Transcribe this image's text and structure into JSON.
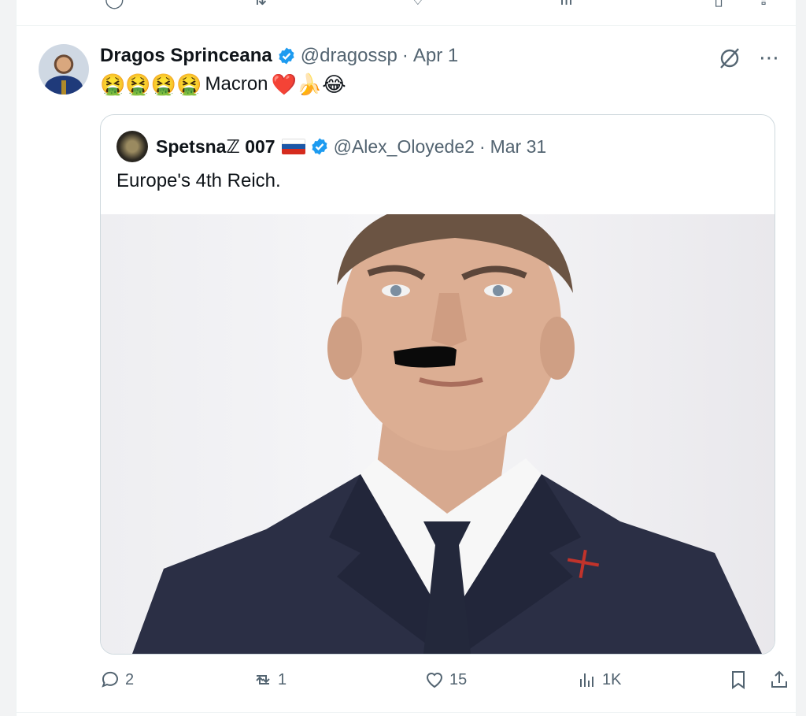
{
  "tweet": {
    "display_name": "Dragos Sprinceana",
    "handle": "@dragossp",
    "date": "Apr 1",
    "dot": "·",
    "text": "Macron",
    "emojis_before": "🤮🤮🤮🤮",
    "emojis_after": "❤️🍌😂"
  },
  "quoted": {
    "display_name": "Spetsnaℤ 007",
    "handle": "@Alex_Oloyede2",
    "date": "Mar 31",
    "dot": "·",
    "text": "Europe's 4th Reich."
  },
  "actions": {
    "replies": "2",
    "reposts": "1",
    "likes": "15",
    "views": "1K"
  },
  "icons": [
    "reply-icon",
    "repost-icon",
    "like-icon",
    "views-icon",
    "bookmark-icon",
    "share-icon",
    "grok-icon",
    "more-icon",
    "verified-icon"
  ],
  "colors": {
    "verified": "#1d9bf0",
    "muted": "#536471",
    "text": "#0f1419",
    "border": "#cfd9de"
  }
}
